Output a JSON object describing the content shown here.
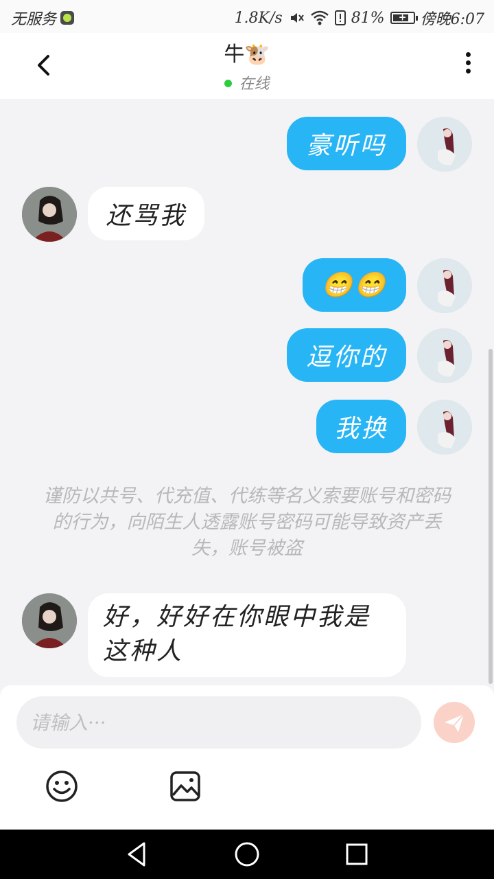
{
  "status_bar": {
    "carrier": "无服务",
    "net_speed": "1.8K/s",
    "battery_text": "81%",
    "battery_level": 0.81,
    "time": "傍晚6:07"
  },
  "header": {
    "title": "牛🐮",
    "status": "在线"
  },
  "messages": [
    {
      "side": "out",
      "text": "豪听吗"
    },
    {
      "side": "in",
      "text": "还骂我"
    },
    {
      "side": "out",
      "text": "😁😁"
    },
    {
      "side": "out",
      "text": "逗你的"
    },
    {
      "side": "out",
      "text": "我换"
    },
    {
      "side": "in",
      "text": "好，好好在你眼中我是这种人"
    }
  ],
  "notice": "谨防以共号、代充值、代练等名义索要账号和密码的行为，向陌生人透露账号密码可能导致资产丢失，账号被盗",
  "composer": {
    "placeholder": "请输入···",
    "value": ""
  },
  "colors": {
    "bubble_out": "#27b5f5",
    "bubble_in": "#ffffff",
    "send_button": "#fbd2c8",
    "online_dot": "#2ecc40"
  },
  "icons": [
    "back-icon",
    "more-icon",
    "emoji-icon",
    "image-icon",
    "send-icon",
    "nav-back-icon",
    "nav-home-icon",
    "nav-recents-icon"
  ]
}
